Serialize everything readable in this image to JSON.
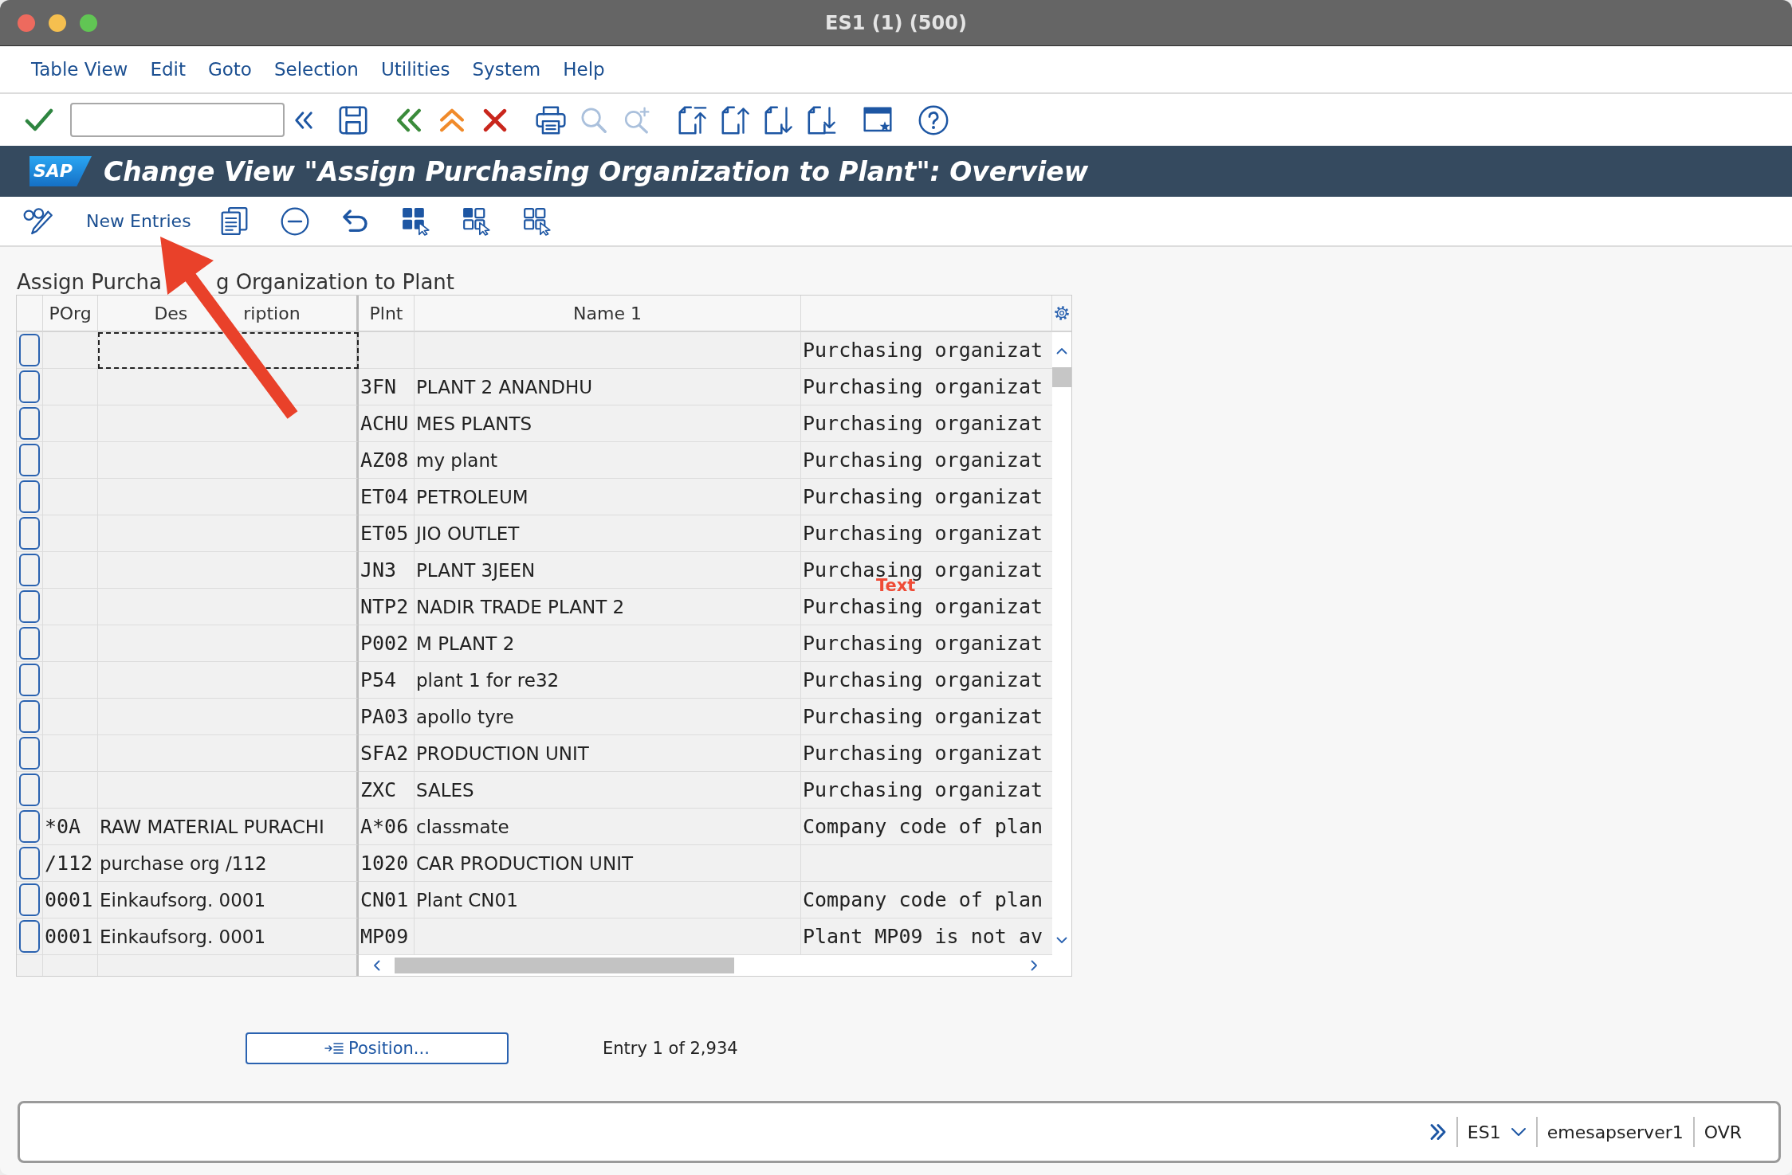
{
  "window": {
    "title": "ES1 (1) (500)"
  },
  "menu": [
    "Table View",
    "Edit",
    "Goto",
    "Selection",
    "Utilities",
    "System",
    "Help"
  ],
  "toolbar": {
    "groups": [
      [
        {
          "kind": "enter",
          "disabled": false
        },
        {
          "kind": "command_field",
          "disabled": false
        },
        {
          "kind": "collapse",
          "disabled": false
        }
      ],
      [
        {
          "kind": "save",
          "disabled": false
        }
      ],
      [
        {
          "kind": "back",
          "disabled": false
        },
        {
          "kind": "exit",
          "disabled": false
        },
        {
          "kind": "cancel",
          "disabled": false
        }
      ],
      [
        {
          "kind": "print",
          "disabled": false
        },
        {
          "kind": "find",
          "disabled": true
        },
        {
          "kind": "find_next",
          "disabled": true
        }
      ],
      [
        {
          "kind": "first_page",
          "disabled": false
        },
        {
          "kind": "previous_page",
          "disabled": false
        },
        {
          "kind": "next_page",
          "disabled": false
        },
        {
          "kind": "last_page",
          "disabled": false
        }
      ],
      [
        {
          "kind": "layout",
          "disabled": false
        }
      ],
      [
        {
          "kind": "help",
          "disabled": false
        }
      ]
    ]
  },
  "screen": {
    "logo": "SAP",
    "title": "Change View \"Assign Purchasing Organization to Plant\": Overview"
  },
  "app_toolbar": [
    {
      "kind": "display_change"
    },
    {
      "kind": "text",
      "label": "New Entries"
    },
    {
      "kind": "copy"
    },
    {
      "kind": "delete"
    },
    {
      "kind": "undo"
    },
    {
      "kind": "select_all"
    },
    {
      "kind": "select_block"
    },
    {
      "kind": "deselect_all"
    }
  ],
  "table": {
    "title_parts": [
      "Assign Purcha",
      "g Organization to Plant"
    ],
    "columns": [
      [
        "POrg"
      ],
      [
        "Des",
        "ription"
      ],
      [
        "Plnt"
      ],
      [
        "Name 1"
      ]
    ],
    "rows": [
      {
        "selected": false,
        "focused": true,
        "column_5": "Purchasing organizat"
      },
      {
        "selected": false,
        "focused": false,
        "plnt": "3FN",
        "name_1": "PLANT 2 ANANDHU",
        "column_5": "Purchasing organizat"
      },
      {
        "selected": false,
        "focused": false,
        "plnt": "ACHU",
        "name_1": "MES PLANTS",
        "column_5": "Purchasing organizat"
      },
      {
        "selected": false,
        "focused": false,
        "plnt": "AZ08",
        "name_1": "my plant",
        "column_5": "Purchasing organizat"
      },
      {
        "selected": false,
        "focused": false,
        "plnt": "ET04",
        "name_1": "PETROLEUM",
        "column_5": "Purchasing organizat"
      },
      {
        "selected": false,
        "focused": false,
        "plnt": "ET05",
        "name_1": "JIO OUTLET",
        "column_5": "Purchasing organizat"
      },
      {
        "selected": false,
        "focused": false,
        "plnt": "JN3",
        "name_1": "PLANT 3JEEN",
        "column_5": "Purchasing organizat"
      },
      {
        "selected": false,
        "focused": false,
        "plnt": "NTP2",
        "name_1": "NADIR TRADE PLANT 2",
        "column_5": "Purchasing organizat"
      },
      {
        "selected": false,
        "focused": false,
        "plnt": "P002",
        "name_1": "M PLANT 2",
        "column_5": "Purchasing organizat"
      },
      {
        "selected": false,
        "focused": false,
        "plnt": "P54",
        "name_1": "plant 1 for re32",
        "column_5": "Purchasing organizat"
      },
      {
        "selected": false,
        "focused": false,
        "plnt": "PA03",
        "name_1": "apollo tyre",
        "column_5": "Purchasing organizat"
      },
      {
        "selected": false,
        "focused": false,
        "plnt": "SFA2",
        "name_1": "PRODUCTION UNIT",
        "column_5": "Purchasing organizat"
      },
      {
        "selected": false,
        "focused": false,
        "plnt": "ZXC",
        "name_1": "SALES",
        "column_5": "Purchasing organizat"
      },
      {
        "selected": false,
        "focused": false,
        "porg": "*0A",
        "description": "RAW MATERIAL PURACHI",
        "plnt": "A*06",
        "name_1": "classmate",
        "column_5": "Company code of plan"
      },
      {
        "selected": false,
        "focused": false,
        "porg": "/112",
        "description": "purchase org /112",
        "plnt": "1020",
        "name_1": "CAR PRODUCTION UNIT"
      },
      {
        "selected": false,
        "focused": false,
        "porg": "0001",
        "description": "Einkaufsorg. 0001",
        "plnt": "CN01",
        "name_1": "Plant CN01",
        "column_5": "Company code of plan"
      },
      {
        "selected": false,
        "focused": false,
        "porg": "0001",
        "description": "Einkaufsorg. 0001",
        "plnt": "MP09",
        "column_5": "Plant MP09 is not av"
      }
    ]
  },
  "position_button": "Position...",
  "entry_info": "Entry 1 of 2,934",
  "status_bar": {
    "system": "ES1",
    "server": "emesapserver1",
    "mode": "OVR"
  },
  "annotations": [
    {
      "kind": "arrow"
    },
    {
      "kind": "label",
      "text": "Text"
    }
  ]
}
